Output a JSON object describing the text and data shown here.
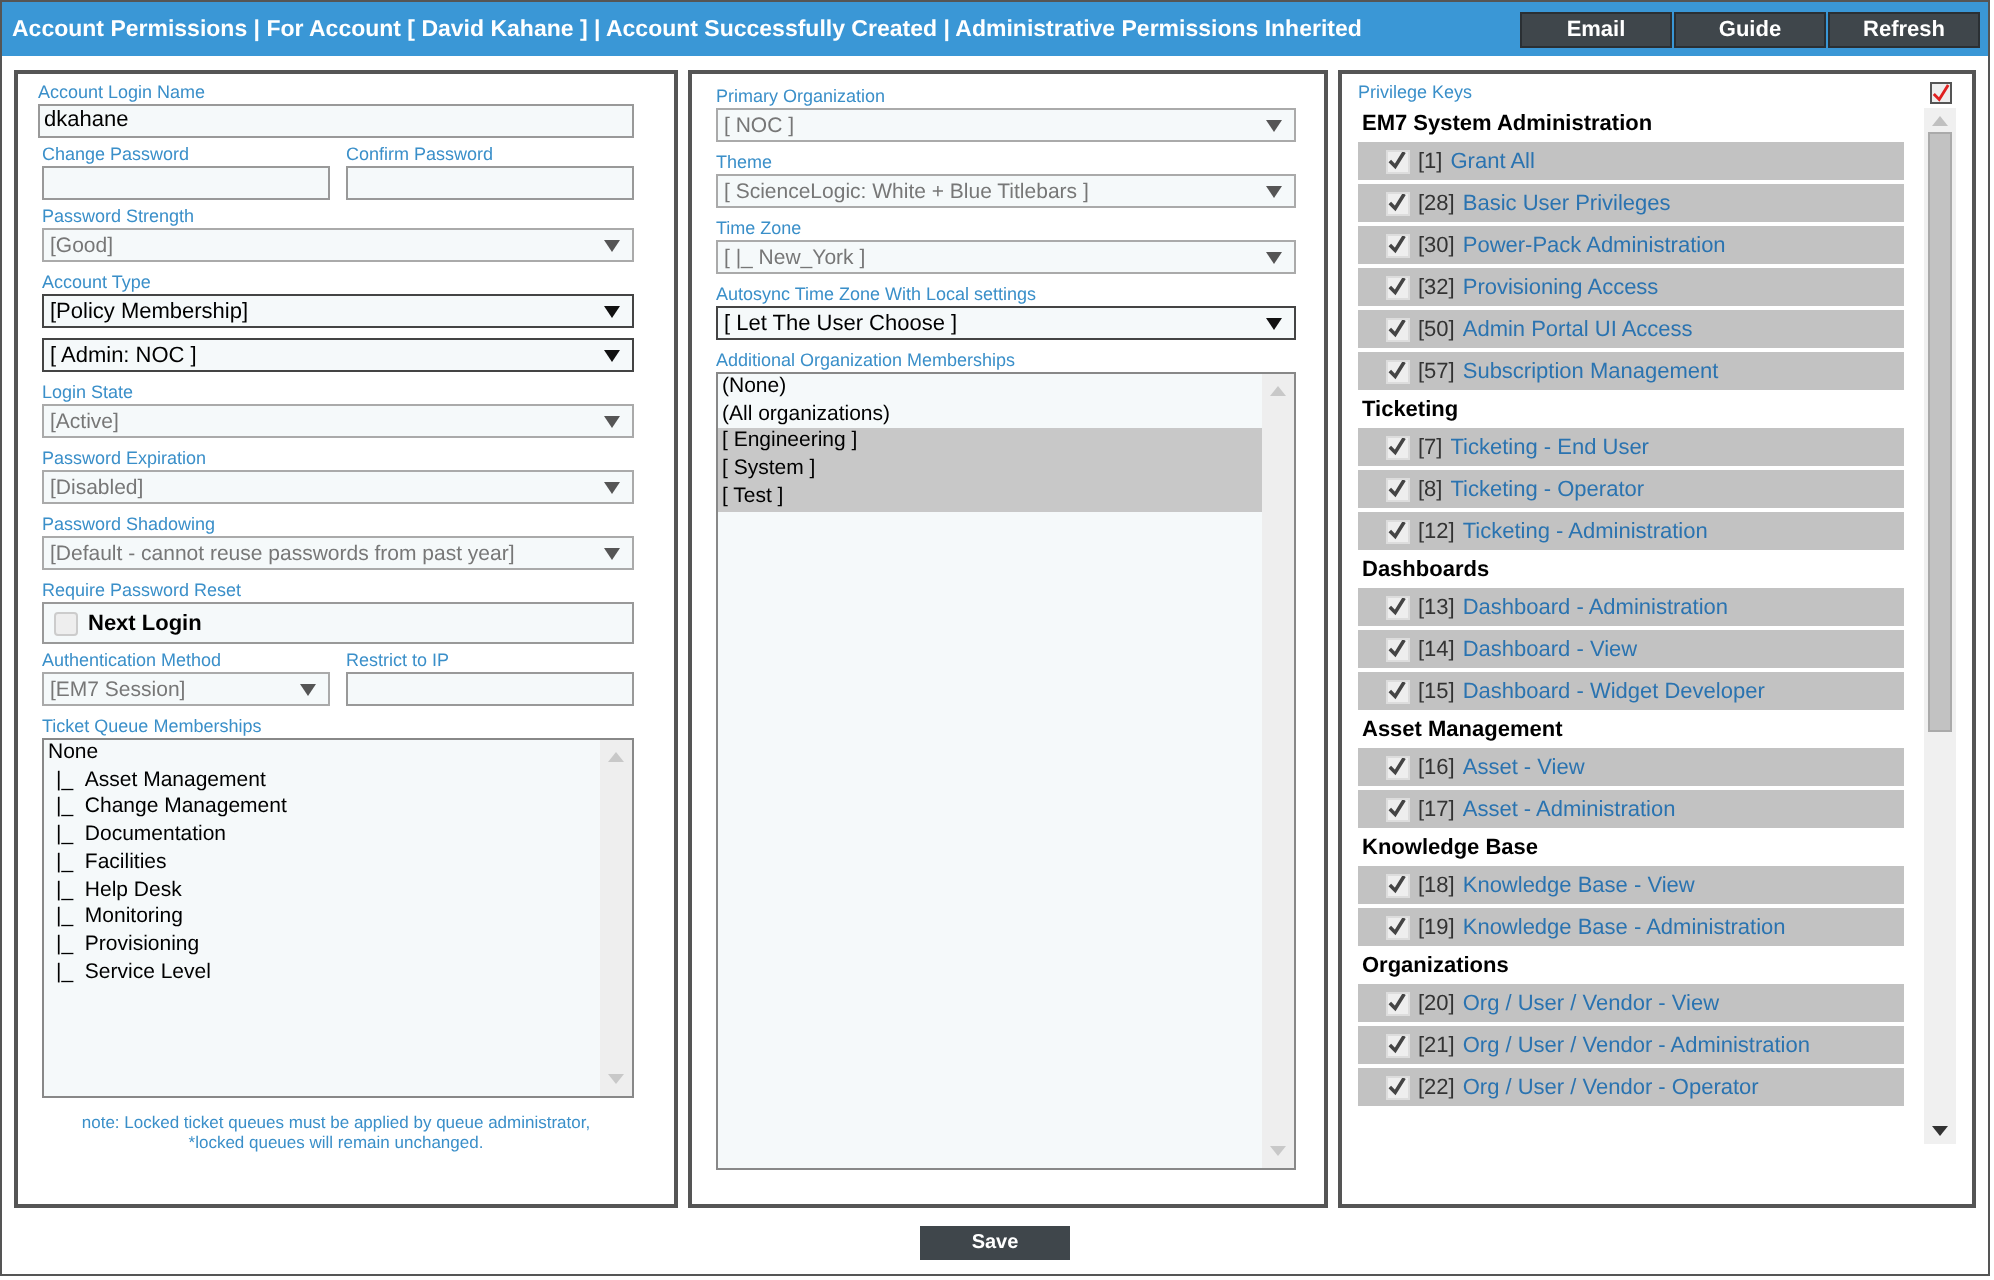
{
  "title": "Account Permissions | For Account [ David Kahane ] | Account Successfully Created | Administrative Permissions Inherited",
  "header_buttons": [
    "Email",
    "Guide",
    "Refresh"
  ],
  "left": {
    "rows": [
      [
        {
          "kind": "text",
          "label": "Account Login Name",
          "value": "dkahane"
        }
      ],
      [
        {
          "kind": "text",
          "label": "Change Password"
        },
        {
          "kind": "text",
          "label": "Confirm Password"
        }
      ],
      [
        {
          "kind": "select",
          "label": "Password Strength",
          "value": "[Good]",
          "disabled": true
        }
      ],
      [
        {
          "kind": "select",
          "label": "Account Type",
          "value": "[Policy Membership]",
          "disabled": false
        }
      ],
      [
        {
          "kind": "select",
          "value": "[ Admin: NOC ]",
          "disabled": false
        }
      ],
      [
        {
          "kind": "select",
          "label": "Login State",
          "value": "[Active]",
          "disabled": true
        }
      ],
      [
        {
          "kind": "select",
          "label": "Password Expiration",
          "value": "[Disabled]",
          "disabled": true
        }
      ],
      [
        {
          "kind": "select",
          "label": "Password Shadowing",
          "value": "[Default - cannot reuse passwords from past year]",
          "disabled": true
        }
      ],
      [
        {
          "kind": "checkbox",
          "label": "Require Password Reset",
          "option": "Next Login",
          "checked": false
        }
      ],
      [
        {
          "kind": "select",
          "label": "Authentication Method",
          "value": "[EM7 Session]",
          "disabled": true
        },
        {
          "kind": "text",
          "label": "Restrict to IP"
        }
      ],
      [
        {
          "kind": "tree",
          "label": "Ticket Queue Memberships",
          "items": [
            {
              "label": "None",
              "children": [
                {
                  "marker": "|_",
                  "label": "Asset Management"
                },
                {
                  "marker": "|_",
                  "label": "Change Management"
                },
                {
                  "marker": "|_",
                  "label": "Documentation"
                },
                {
                  "marker": "|_",
                  "label": "Facilities"
                },
                {
                  "marker": "|_",
                  "label": "Help Desk"
                },
                {
                  "marker": "|_",
                  "label": "Monitoring"
                },
                {
                  "marker": "|_",
                  "label": "Provisioning"
                },
                {
                  "marker": "|_",
                  "label": "Service Level"
                }
              ]
            }
          ]
        }
      ]
    ],
    "note": [
      "note: Locked ticket queues must be applied by queue administrator,",
      "*locked queues will remain unchanged."
    ]
  },
  "middle": {
    "rows": [
      [
        {
          "kind": "select",
          "label": "Primary Organization",
          "value": "[ NOC ]",
          "disabled": true
        }
      ],
      [
        {
          "kind": "select",
          "label": "Theme",
          "value": "[ ScienceLogic: White + Blue Titlebars ]",
          "disabled": true
        }
      ],
      [
        {
          "kind": "select",
          "label": "Time Zone",
          "value": "[ |_ New_York ]",
          "disabled": true
        }
      ],
      [
        {
          "kind": "select",
          "label": "Autosync Time Zone With Local settings",
          "value": "[ Let The User Choose ]",
          "disabled": false
        }
      ],
      [
        {
          "kind": "list",
          "label": "Additional Organization Memberships",
          "items": [
            {
              "label": "(None)",
              "selected": false
            },
            {
              "label": "(All organizations)",
              "selected": false
            },
            {
              "label": "[ Engineering ]",
              "selected": true
            },
            {
              "label": "[ System ]",
              "selected": true
            },
            {
              "label": "[ Test ]",
              "selected": true
            }
          ]
        }
      ]
    ]
  },
  "privileges": {
    "label": "Privilege Keys",
    "all_checked": true,
    "groups": [
      {
        "title": "EM7 System Administration",
        "items": [
          {
            "id": "[1]",
            "label": "Grant All",
            "checked": true
          },
          {
            "id": "[28]",
            "label": "Basic User Privileges",
            "checked": true
          },
          {
            "id": "[30]",
            "label": "Power-Pack Administration",
            "checked": true
          },
          {
            "id": "[32]",
            "label": "Provisioning Access",
            "checked": true
          },
          {
            "id": "[50]",
            "label": "Admin Portal UI Access",
            "checked": true
          },
          {
            "id": "[57]",
            "label": "Subscription Management",
            "checked": true
          }
        ]
      },
      {
        "title": "Ticketing",
        "items": [
          {
            "id": "[7]",
            "label": "Ticketing - End User",
            "checked": true
          },
          {
            "id": "[8]",
            "label": "Ticketing - Operator",
            "checked": true
          },
          {
            "id": "[12]",
            "label": "Ticketing - Administration",
            "checked": true
          }
        ]
      },
      {
        "title": "Dashboards",
        "items": [
          {
            "id": "[13]",
            "label": "Dashboard - Administration",
            "checked": true
          },
          {
            "id": "[14]",
            "label": "Dashboard - View",
            "checked": true
          },
          {
            "id": "[15]",
            "label": "Dashboard - Widget Developer",
            "checked": true
          }
        ]
      },
      {
        "title": "Asset Management",
        "items": [
          {
            "id": "[16]",
            "label": "Asset - View",
            "checked": true
          },
          {
            "id": "[17]",
            "label": "Asset - Administration",
            "checked": true
          }
        ]
      },
      {
        "title": "Knowledge Base",
        "items": [
          {
            "id": "[18]",
            "label": "Knowledge Base - View",
            "checked": true
          },
          {
            "id": "[19]",
            "label": "Knowledge Base - Administration",
            "checked": true
          }
        ]
      },
      {
        "title": "Organizations",
        "items": [
          {
            "id": "[20]",
            "label": "Org / User / Vendor - View",
            "checked": true
          },
          {
            "id": "[21]",
            "label": "Org / User / Vendor - Administration",
            "checked": true
          },
          {
            "id": "[22]",
            "label": "Org / User / Vendor - Operator",
            "checked": true
          }
        ]
      }
    ]
  },
  "save_button": "Save"
}
